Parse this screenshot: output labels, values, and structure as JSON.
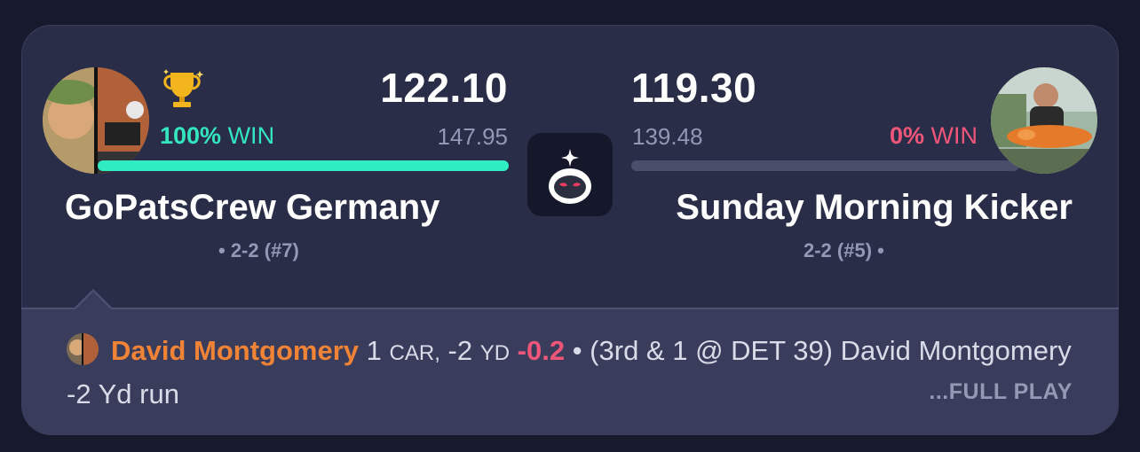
{
  "left_team": {
    "name": "GoPatsCrew Germany",
    "score": "122.10",
    "projected": "147.95",
    "win_pct": "100%",
    "win_label": "WIN",
    "record": "• 2-2 (#7)",
    "win_fraction": 1.0,
    "accent": "#30ecc2"
  },
  "right_team": {
    "name": "Sunday Morning Kicker",
    "score": "119.30",
    "projected": "139.48",
    "win_pct": "0%",
    "win_label": "WIN",
    "record": "2-2 (#5) •",
    "win_fraction": 0.0,
    "accent": "#f0567a"
  },
  "icons": {
    "trophy": "trophy-icon",
    "center_logo": "sleeper-logo-icon"
  },
  "play": {
    "player_name": "David Montgomery",
    "car_count": "1",
    "car_label": "CAR,",
    "yards": "-2",
    "yd_label": "YD",
    "points": "-0.2",
    "description": "• (3rd & 1 @ DET 39) David Montgomery -2 Yd run",
    "full_play_label": "...FULL PLAY"
  },
  "colors": {
    "background": "#171a2c",
    "card": "#2a2d47",
    "feed": "#393d5b",
    "player_name": "#f08336",
    "win_positive": "#33e6c0",
    "win_negative": "#f0567a"
  }
}
